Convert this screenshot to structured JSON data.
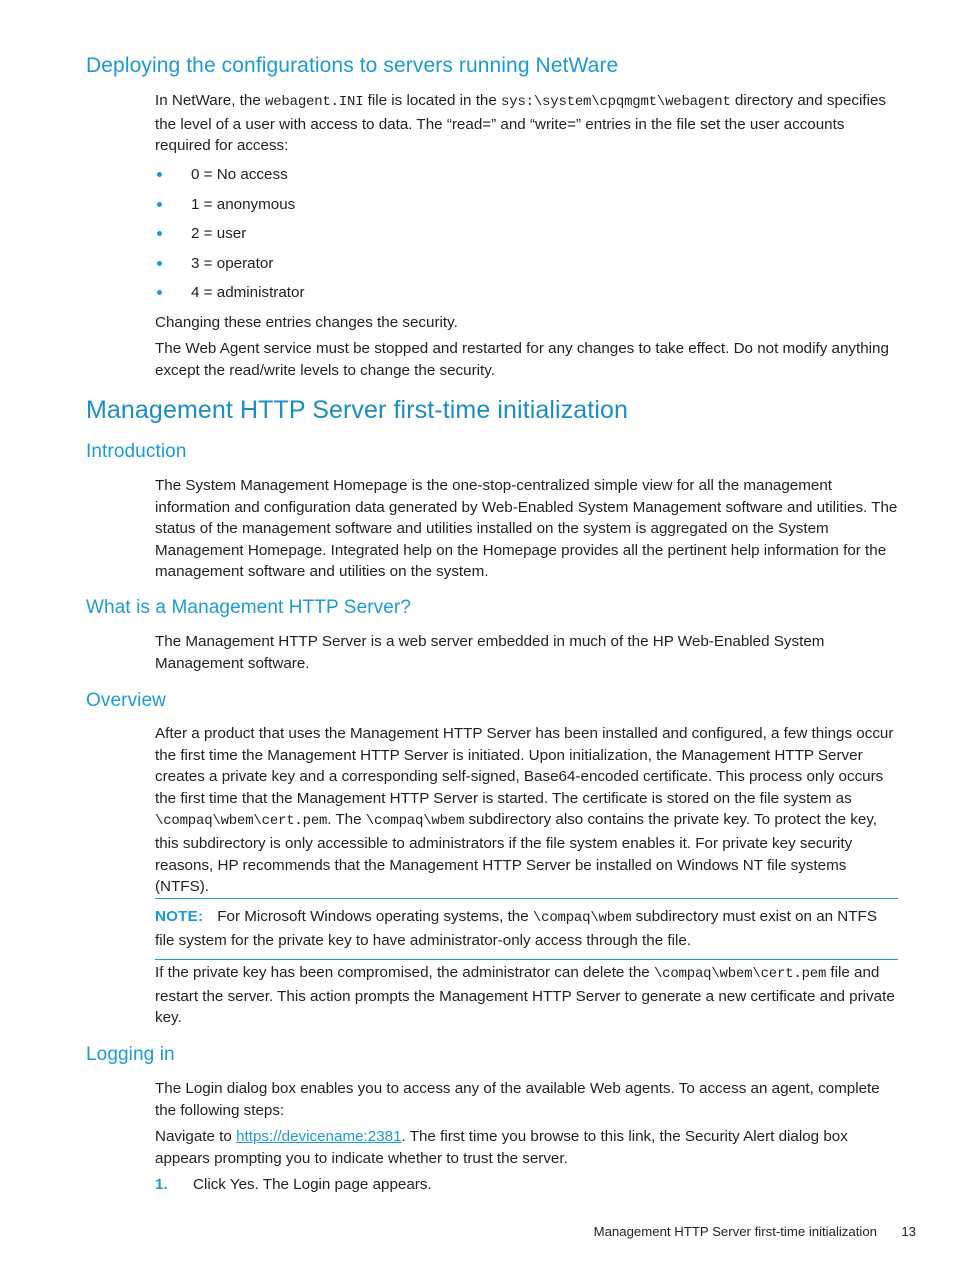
{
  "document": {
    "page_number": "13",
    "footer_title": "Management HTTP Server first-time initialization",
    "accent_color": "#1b9ad6",
    "heading_color": "#1a8ec4",
    "text_color": "#231f20"
  },
  "sections": {
    "netware": {
      "heading": "Deploying the configurations to servers running NetWare",
      "intro_1": "In NetWare, the ",
      "intro_mono_1": "webagent.INI",
      "intro_2": " file is located in the ",
      "intro_mono_2": "sys:\\system\\cpqmgmt\\webagent",
      "intro_3": " directory and specifies the level of a user with access to data. The “read=” and “write=” entries in the file set the user accounts required for access:",
      "access_levels": [
        "0 = No access",
        "1 = anonymous",
        "2 = user",
        "3 = operator",
        "4 = administrator"
      ],
      "after_list_1": "Changing these entries changes the security.",
      "after_list_2": "The Web Agent service must be stopped and restarted for any changes to take effect. Do not modify anything except the read/write levels to change the security."
    },
    "init": {
      "heading": "Management HTTP Server first-time initialization"
    },
    "introduction": {
      "heading": "Introduction",
      "body": "The System Management Homepage is the one-stop-centralized simple view for all the management information and configuration data generated by Web-Enabled System Management software and utilities. The status of the management software and utilities installed on the system is aggregated on the System Management Homepage. Integrated help on the Homepage provides all the pertinent help information for the management software and utilities on the system."
    },
    "what_is": {
      "heading": "What is a Management HTTP Server?",
      "body": "The Management HTTP Server is a web server embedded in much of the HP Web-Enabled System Management software."
    },
    "overview": {
      "heading": "Overview",
      "body_1": "After a product that uses the Management HTTP Server has been installed and configured, a few things occur the first time the Management HTTP Server is initiated. Upon initialization, the Management HTTP Server creates a private key and a corresponding self-signed, Base64-encoded certificate. This process only occurs the first time that the Management HTTP Server is started. The certificate is stored on the file system as ",
      "body_mono_1": "\\compaq\\wbem\\cert.pem",
      "body_2": ". The ",
      "body_mono_2": "\\compaq\\wbem",
      "body_3": " subdirectory also contains the private key. To protect the key, this subdirectory is only accessible to administrators if the file system enables it. For private key security reasons, HP recommends that the Management HTTP Server be installed on Windows NT file systems (NTFS).",
      "note_label": "NOTE:",
      "note_1": "For Microsoft Windows operating systems, the ",
      "note_mono_1": "\\compaq\\wbem",
      "note_2": " subdirectory must exist on an NTFS file system for the private key to have administrator-only access through the file.",
      "after_note_1": "If the private key has been compromised, the administrator can delete the ",
      "after_note_mono_1": "\\compaq\\wbem\\",
      "after_note_mono_2": "cert.pem",
      "after_note_2": " file and restart the server. This action prompts the Management HTTP Server to generate a new certificate and private key."
    },
    "logging_in": {
      "heading": "Logging in",
      "body_1": "The Login dialog box enables you to access any of the available Web agents. To access an agent, complete the following steps:",
      "nav_prefix": "Navigate to ",
      "nav_link": "https://devicename:2381",
      "nav_suffix": ". The first time you browse to this link, the Security Alert dialog box appears prompting you to indicate whether to trust the server.",
      "step_1_marker": "1.",
      "step_1_text": "Click Yes. The Login page appears."
    }
  }
}
